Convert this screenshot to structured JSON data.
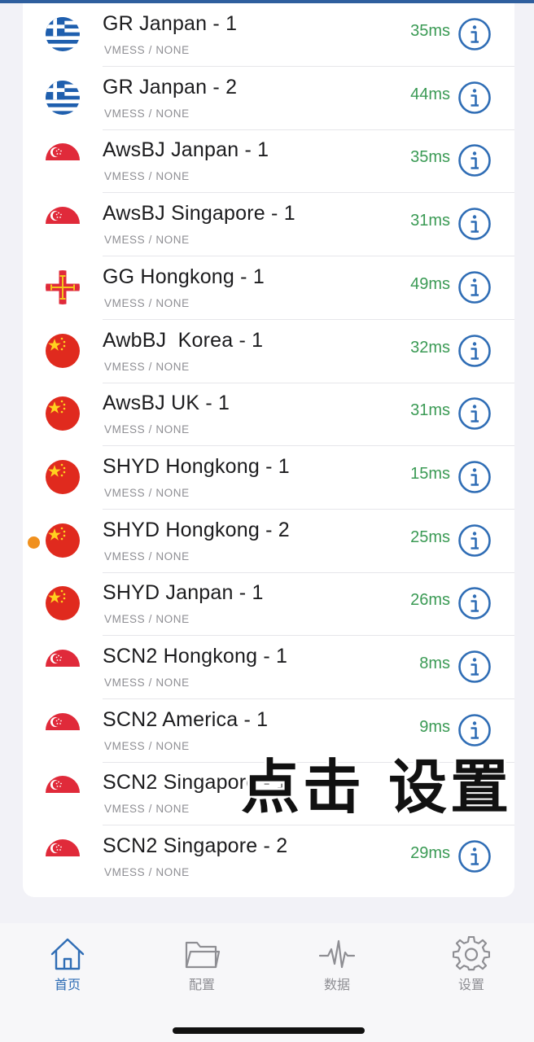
{
  "servers": [
    {
      "name": "GR Janpan - 1",
      "protocol": "VMESS / NONE",
      "latency": "35ms",
      "flag": "greece-flag-icon",
      "active": false
    },
    {
      "name": "GR Janpan - 2",
      "protocol": "VMESS / NONE",
      "latency": "44ms",
      "flag": "greece-flag-icon",
      "active": false
    },
    {
      "name": "AwsBJ Janpan - 1",
      "protocol": "VMESS / NONE",
      "latency": "35ms",
      "flag": "singapore-flag-icon",
      "active": false
    },
    {
      "name": "AwsBJ Singapore - 1",
      "protocol": "VMESS / NONE",
      "latency": "31ms",
      "flag": "singapore-flag-icon",
      "active": false
    },
    {
      "name": "GG Hongkong - 1",
      "protocol": "VMESS / NONE",
      "latency": "49ms",
      "flag": "guernsey-flag-icon",
      "active": false
    },
    {
      "name": "AwbBJ  Korea - 1",
      "protocol": "VMESS / NONE",
      "latency": "32ms",
      "flag": "china-flag-icon",
      "active": false
    },
    {
      "name": "AwsBJ UK - 1",
      "protocol": "VMESS / NONE",
      "latency": "31ms",
      "flag": "china-flag-icon",
      "active": false
    },
    {
      "name": "SHYD Hongkong - 1",
      "protocol": "VMESS / NONE",
      "latency": "15ms",
      "flag": "china-flag-icon",
      "active": false
    },
    {
      "name": "SHYD Hongkong - 2",
      "protocol": "VMESS / NONE",
      "latency": "25ms",
      "flag": "china-flag-icon",
      "active": true
    },
    {
      "name": "SHYD Janpan - 1",
      "protocol": "VMESS / NONE",
      "latency": "26ms",
      "flag": "china-flag-icon",
      "active": false
    },
    {
      "name": "SCN2 Hongkong - 1",
      "protocol": "VMESS / NONE",
      "latency": "8ms",
      "flag": "singapore-flag-icon",
      "active": false
    },
    {
      "name": "SCN2 America - 1",
      "protocol": "VMESS / NONE",
      "latency": "9ms",
      "flag": "singapore-flag-icon",
      "active": false
    },
    {
      "name": "SCN2 Singapore - 1",
      "protocol": "VMESS / NONE",
      "latency": "",
      "flag": "singapore-flag-icon",
      "active": false
    },
    {
      "name": "SCN2 Singapore - 2",
      "protocol": "VMESS / NONE",
      "latency": "29ms",
      "flag": "singapore-flag-icon",
      "active": false
    }
  ],
  "overlay": {
    "caption": "点击 设置"
  },
  "tabbar": {
    "tabs": [
      {
        "label": "首页",
        "icon": "home-icon",
        "active": true
      },
      {
        "label": "配置",
        "icon": "folder-icon",
        "active": false
      },
      {
        "label": "数据",
        "icon": "activity-icon",
        "active": false
      },
      {
        "label": "设置",
        "icon": "gear-icon",
        "active": false
      }
    ]
  },
  "colors": {
    "accent": "#2f6db5",
    "latency": "#3a9a54",
    "active_dot": "#f0901e",
    "info_icon": "#2f6db5"
  }
}
